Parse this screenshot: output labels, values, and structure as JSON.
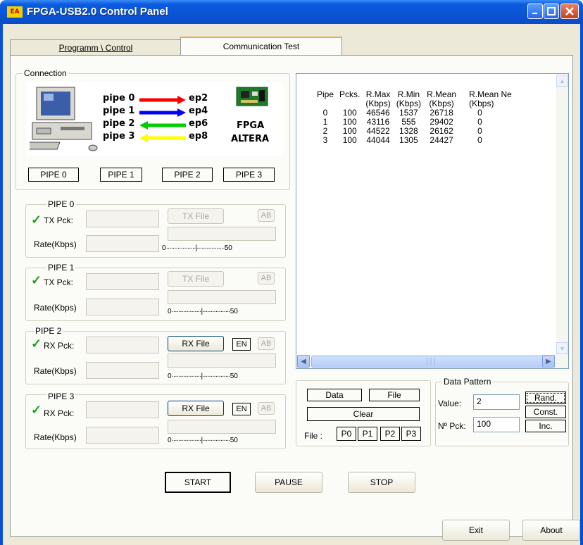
{
  "window": {
    "title": "FPGA-USB2.0 Control Panel",
    "icon_text": "EA",
    "icon": "app-icon",
    "accent": "#0a54d4"
  },
  "tabs": [
    {
      "label": "Programm \\ Control",
      "selected": false
    },
    {
      "label": "Communication Test",
      "selected": true
    }
  ],
  "connection": {
    "title": "Connection",
    "pipes": [
      {
        "label": "pipe 0",
        "ep": "ep2",
        "arrow_color": "#ff0000",
        "direction": "right"
      },
      {
        "label": "pipe 1",
        "ep": "ep4",
        "arrow_color": "#0000ff",
        "direction": "right"
      },
      {
        "label": "pipe 2",
        "ep": "ep6",
        "arrow_color": "#00cc00",
        "direction": "left"
      },
      {
        "label": "pipe 3",
        "ep": "ep8",
        "arrow_color": "#ffff00",
        "direction": "left"
      }
    ],
    "fpga_label": "FPGA",
    "vendor_label": "ALTERA",
    "pipe_buttons": [
      "PIPE 0",
      "PIPE 1",
      "PIPE 2",
      "PIPE 3"
    ]
  },
  "pipe_groups": [
    {
      "title": "PIPE 0",
      "pck_label": "TX Pck:",
      "pck_value": "",
      "file_button": "TX File",
      "file_enabled": false,
      "en_button": "",
      "ab_button": "AB",
      "rate_label": "Rate(Kbps)",
      "rate_value": "",
      "scale_min": "0",
      "scale_max": "50",
      "checked": true
    },
    {
      "title": "PIPE 1",
      "pck_label": "TX Pck:",
      "pck_value": "",
      "file_button": "TX File",
      "file_enabled": false,
      "en_button": "",
      "ab_button": "AB",
      "rate_label": "Rate(Kbps)",
      "rate_value": "",
      "scale_min": "0",
      "scale_max": "50",
      "checked": true
    },
    {
      "title": "PIPE 2",
      "pck_label": "RX Pck:",
      "pck_value": "",
      "file_button": "RX File",
      "file_enabled": true,
      "en_button": "EN",
      "ab_button": "AB",
      "rate_label": "Rate(Kbps)",
      "rate_value": "",
      "scale_min": "0",
      "scale_max": "50",
      "checked": true
    },
    {
      "title": "PIPE 3",
      "pck_label": "RX Pck:",
      "pck_value": "",
      "file_button": "RX File",
      "file_enabled": true,
      "en_button": "EN",
      "ab_button": "AB",
      "rate_label": "Rate(Kbps)",
      "rate_value": "",
      "scale_min": "0",
      "scale_max": "50",
      "checked": true
    }
  ],
  "results": {
    "headers": [
      "Pipe",
      "Pcks.",
      "R.Max",
      "R.Min",
      "R.Mean",
      "R.Mean Ne"
    ],
    "units": [
      "",
      "",
      "(Kbps)",
      "(Kbps)",
      "(Kbps)",
      "(Kbps)"
    ],
    "rows": [
      [
        "0",
        "100",
        "46546",
        "1537",
        "26718",
        "0"
      ],
      [
        "1",
        "100",
        "43116",
        "555",
        "29402",
        "0"
      ],
      [
        "2",
        "100",
        "44522",
        "1328",
        "26162",
        "0"
      ],
      [
        "3",
        "100",
        "44044",
        "1305",
        "24427",
        "0"
      ]
    ]
  },
  "data_panel": {
    "data_button": "Data",
    "file_button": "File",
    "clear_button": "Clear",
    "file_label": "File :",
    "pipe_file_buttons": [
      "P0",
      "P1",
      "P2",
      "P3"
    ]
  },
  "data_pattern": {
    "title": "Data Pattern",
    "value_label": "Value:",
    "value": "2",
    "npck_label": "Nº Pck:",
    "npck_value": "100",
    "rand_button": "Rand.",
    "const_button": "Const.",
    "inc_button": "Inc."
  },
  "controls": {
    "start": "START",
    "pause": "PAUSE",
    "stop": "STOP"
  },
  "footer": {
    "exit": "Exit",
    "about": "About"
  }
}
